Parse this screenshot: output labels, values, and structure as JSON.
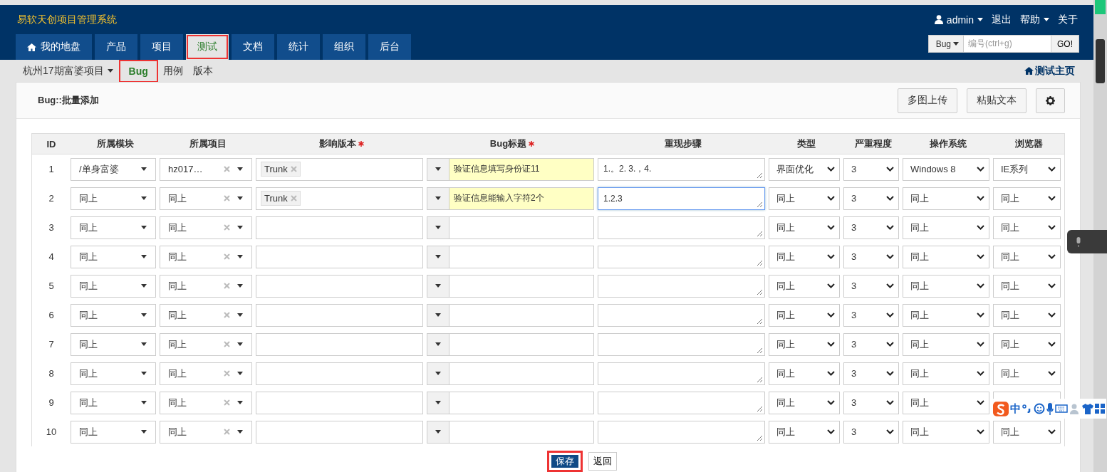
{
  "app": {
    "title": "易软天创项目管理系统"
  },
  "user_menu": [
    {
      "label": "admin",
      "kind": "user"
    },
    {
      "label": "退出",
      "kind": "link"
    },
    {
      "label": "帮助",
      "kind": "dropdown"
    },
    {
      "label": "关于",
      "kind": "link"
    }
  ],
  "nav_tabs": [
    {
      "label": "我的地盘",
      "kind": "home",
      "selected": false,
      "annotated": false
    },
    {
      "label": "产品",
      "kind": "plain",
      "selected": false,
      "annotated": false
    },
    {
      "label": "项目",
      "kind": "plain",
      "selected": false,
      "annotated": false
    },
    {
      "label": "测试",
      "kind": "plain",
      "selected": true,
      "annotated": true
    },
    {
      "label": "文档",
      "kind": "plain",
      "selected": false,
      "annotated": false
    },
    {
      "label": "统计",
      "kind": "plain",
      "selected": false,
      "annotated": false
    },
    {
      "label": "组织",
      "kind": "plain",
      "selected": false,
      "annotated": false
    },
    {
      "label": "后台",
      "kind": "plain",
      "selected": false,
      "annotated": false
    }
  ],
  "search": {
    "type": "Bug",
    "placeholder": "编号(ctrl+g)",
    "button": "GO!"
  },
  "subnav": {
    "project": "杭州17期富婆项目",
    "items": [
      {
        "label": "Bug",
        "selected": true,
        "annotated": true
      },
      {
        "label": "用例",
        "selected": false,
        "annotated": false
      },
      {
        "label": "版本",
        "selected": false,
        "annotated": false
      }
    ],
    "home_link": "测试主页"
  },
  "panel": {
    "title": "Bug::批量添加",
    "buttons": [
      "多图上传",
      "粘贴文本"
    ]
  },
  "table": {
    "columns": [
      {
        "label": "ID",
        "required": false
      },
      {
        "label": "所属模块",
        "required": false
      },
      {
        "label": "所属项目",
        "required": false
      },
      {
        "label": "影响版本",
        "required": true
      },
      {
        "label": "Bug标题",
        "required": true
      },
      {
        "label": "重现步骤",
        "required": false
      },
      {
        "label": "类型",
        "required": false
      },
      {
        "label": "严重程度",
        "required": false
      },
      {
        "label": "操作系统",
        "required": false
      },
      {
        "label": "浏览器",
        "required": false
      }
    ],
    "rows": [
      {
        "id": "1",
        "module": "/单身富婆",
        "project": "hz017…",
        "versions": [
          "Trunk"
        ],
        "title": "验证信息填写身份证11",
        "highlighted": true,
        "steps": "1.。2. 3.，4.",
        "focused": false,
        "type": "界面优化",
        "severity": "3",
        "os": "Windows 8",
        "browser": "IE系列"
      },
      {
        "id": "2",
        "module": "同上",
        "project": "同上",
        "versions": [
          "Trunk"
        ],
        "title": "验证信息能输入字符2个",
        "highlighted": true,
        "steps": "1.2.3",
        "focused": true,
        "type": "同上",
        "severity": "3",
        "os": "同上",
        "browser": "同上"
      },
      {
        "id": "3",
        "module": "同上",
        "project": "同上",
        "highlighted": false,
        "focused": false,
        "type": "同上",
        "severity": "3",
        "os": "同上",
        "browser": "同上"
      },
      {
        "id": "4",
        "module": "同上",
        "project": "同上",
        "highlighted": false,
        "focused": false,
        "type": "同上",
        "severity": "3",
        "os": "同上",
        "browser": "同上"
      },
      {
        "id": "5",
        "module": "同上",
        "project": "同上",
        "highlighted": false,
        "focused": false,
        "type": "同上",
        "severity": "3",
        "os": "同上",
        "browser": "同上"
      },
      {
        "id": "6",
        "module": "同上",
        "project": "同上",
        "highlighted": false,
        "focused": false,
        "type": "同上",
        "severity": "3",
        "os": "同上",
        "browser": "同上"
      },
      {
        "id": "7",
        "module": "同上",
        "project": "同上",
        "highlighted": false,
        "focused": false,
        "type": "同上",
        "severity": "3",
        "os": "同上",
        "browser": "同上"
      },
      {
        "id": "8",
        "module": "同上",
        "project": "同上",
        "highlighted": false,
        "focused": false,
        "type": "同上",
        "severity": "3",
        "os": "同上",
        "browser": "同上"
      },
      {
        "id": "9",
        "module": "同上",
        "project": "同上",
        "highlighted": false,
        "focused": false,
        "type": "同上",
        "severity": "3",
        "os": "同上"
      },
      {
        "id": "10",
        "module": "同上",
        "project": "同上",
        "highlighted": false,
        "focused": false,
        "type": "同上",
        "severity": "3",
        "os": "同上",
        "browser": "同上"
      }
    ]
  },
  "actions": [
    {
      "label": "保存",
      "kind": "primary",
      "annotated": true
    },
    {
      "label": "返回",
      "kind": "secondary",
      "annotated": false
    }
  ],
  "ime_toolbar": {
    "mode": "中"
  }
}
